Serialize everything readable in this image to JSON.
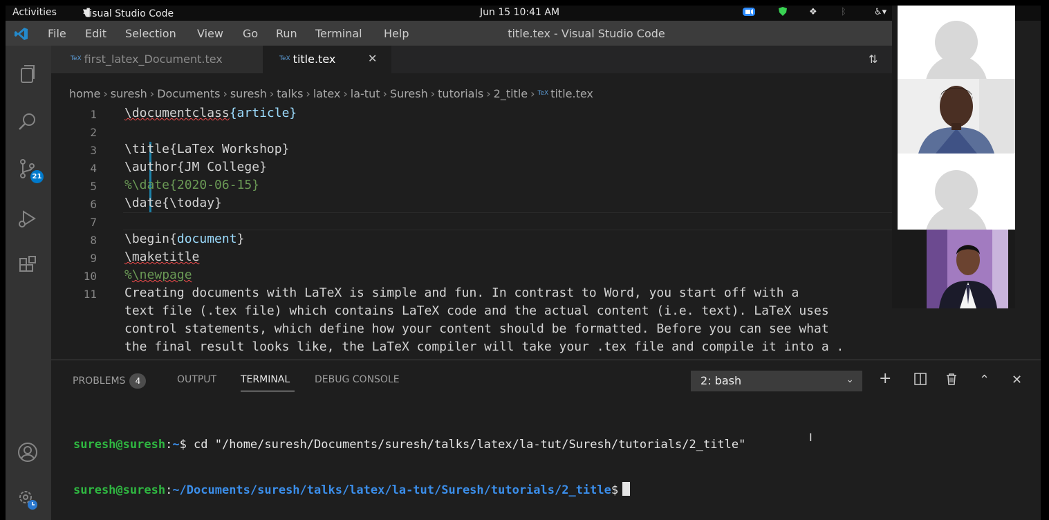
{
  "system_bar": {
    "activities": "Activities",
    "app_name": "Visual Studio Code",
    "datetime": "Jun 15  10:41 AM"
  },
  "menubar": {
    "items": [
      "File",
      "Edit",
      "Selection",
      "View",
      "Go",
      "Run",
      "Terminal",
      "Help"
    ],
    "window_title": "title.tex - Visual Studio Code"
  },
  "activity_bar": {
    "icons": [
      "explorer-icon",
      "search-icon",
      "source-control-icon",
      "run-debug-icon",
      "extensions-icon",
      "accounts-icon",
      "manage-gear-icon"
    ],
    "scm_badge": "21"
  },
  "tabs": [
    {
      "label": "first_latex_Document.tex",
      "active": false
    },
    {
      "label": "title.tex",
      "active": true
    }
  ],
  "tab_close_glyph": "✕",
  "file_icon_text": "TeX",
  "breadcrumb": [
    "home",
    "suresh",
    "Documents",
    "suresh",
    "talks",
    "latex",
    "la-tut",
    "Suresh",
    "tutorials",
    "2_title",
    "title.tex"
  ],
  "editor": {
    "line_numbers": [
      "1",
      "2",
      "3",
      "4",
      "5",
      "6",
      "7",
      "8",
      "9",
      "10",
      "11"
    ],
    "lines": {
      "l1_cmd": "\\documentclass",
      "l1_arg": "{article}",
      "l3": "\\title{LaTex Workshop}",
      "l4": "\\author{JM College}",
      "l5": "%\\date{2020-06-15}",
      "l6": "\\date{\\today}",
      "l8_cmd": "\\begin{",
      "l8_arg": "document",
      "l8_close": "}",
      "l9": "\\maketitle",
      "l10_pct": "%",
      "l10_cmd": "\\newpage",
      "l11": [
        "Creating documents with LaTeX is simple and fun. In contrast to Word, you start off with a",
        "text file (.tex file) which contains LaTeX code and the actual content (i.e. text). LaTeX uses",
        "control statements, which define how your content should be formatted. Before you can see what",
        "the final result looks like, the LaTeX compiler will take your .tex file and compile it into a ."
      ]
    }
  },
  "panel": {
    "tabs": [
      {
        "label": "PROBLEMS",
        "badge": "4"
      },
      {
        "label": "OUTPUT"
      },
      {
        "label": "TERMINAL",
        "active": true
      },
      {
        "label": "DEBUG CONSOLE"
      }
    ],
    "shell_select": "2: bash",
    "actions": [
      "new-terminal",
      "split-terminal",
      "kill-terminal",
      "maximize-panel",
      "close-panel"
    ]
  },
  "terminal": {
    "line1": {
      "user": "suresh@suresh",
      "sep": ":",
      "path": "~",
      "prompt": "$",
      "command": " cd \"/home/suresh/Documents/suresh/talks/latex/la-tut/Suresh/tutorials/2_title\""
    },
    "line2": {
      "user": "suresh@suresh",
      "sep": ":",
      "path": "~/Documents/suresh/talks/latex/la-tut/Suresh/tutorials/2_title",
      "prompt": "$"
    }
  },
  "video_participants": [
    "placeholder-avatar",
    "presenter-video",
    "placeholder-avatar",
    "participant-video"
  ],
  "colors": {
    "editor_bg": "#1e1e1e",
    "activity_bar": "#333333",
    "accent": "#007acc",
    "terminal_user": "#2fb741",
    "terminal_path": "#3b8eea"
  }
}
